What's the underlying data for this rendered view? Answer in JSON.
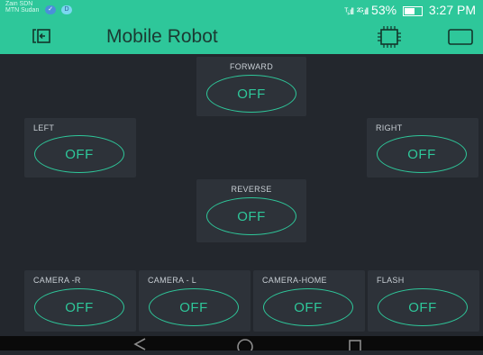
{
  "status_bar": {
    "carrier_line1": "Zain SDN",
    "carrier_line2": "MTN Sudan",
    "icon_a": "✓",
    "icon_b": "D",
    "signal_1": "ᵀᵢ.ıll",
    "signal_2": "²ᴳ.ıll",
    "battery": "53%",
    "time": "3:27 PM"
  },
  "header": {
    "title": "Mobile Robot",
    "left_icon": "back-to-projects-icon",
    "device_icon": "device-chip-icon",
    "right_icon": "empty-box-icon"
  },
  "tiles": [
    {
      "label": "FORWARD",
      "state": "OFF"
    },
    {
      "label": "LEFT",
      "state": "OFF"
    },
    {
      "label": "RIGHT",
      "state": "OFF"
    },
    {
      "label": "REVERSE",
      "state": "OFF"
    },
    {
      "label": "CAMERA -R",
      "state": "OFF"
    },
    {
      "label": "CAMERA - L",
      "state": "OFF"
    },
    {
      "label": "CAMERA-HOME",
      "state": "OFF"
    },
    {
      "label": "FLASH",
      "state": "OFF"
    }
  ],
  "nav_bar": {
    "back_icon": "back-triangle-icon",
    "home_icon": "home-circle-icon",
    "recents_icon": "recents-square-icon"
  },
  "colors": {
    "accent": "#2ec79a",
    "background": "#23272d",
    "tile": "#2d3239"
  }
}
